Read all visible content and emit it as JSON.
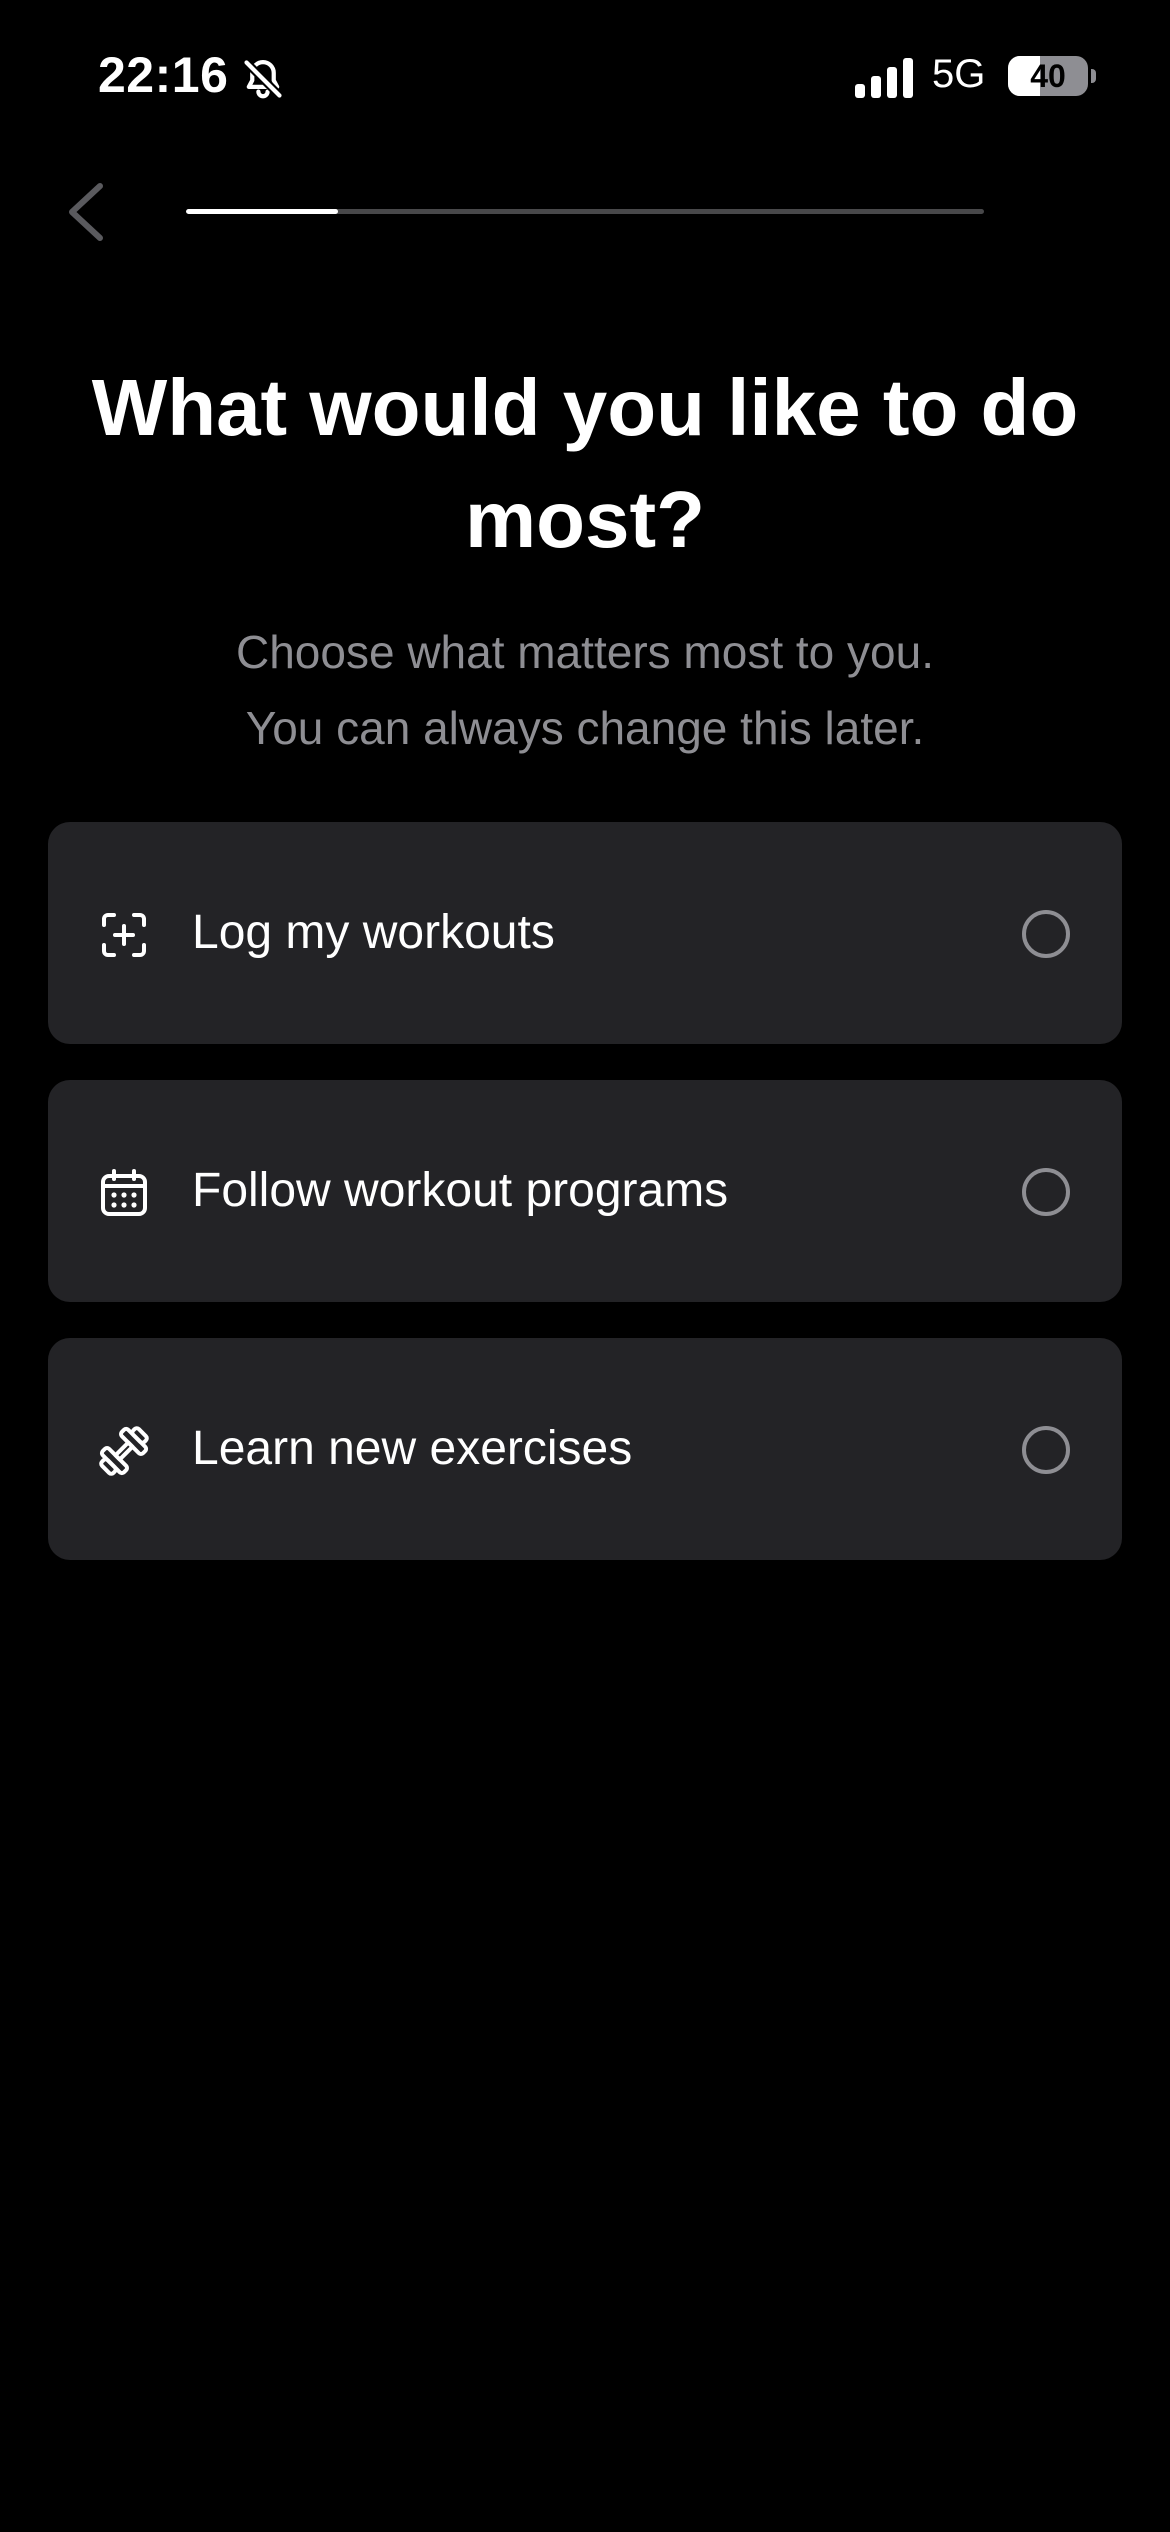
{
  "status_bar": {
    "time": "22:16",
    "network": "5G",
    "battery_level": "40",
    "battery_fraction": 0.4,
    "bell_icon": "bell-slash-icon",
    "signal_icon": "cellular-signal-icon"
  },
  "nav": {
    "back_icon": "chevron-left-icon",
    "progress_fraction": 0.19
  },
  "header": {
    "title": "What would you like to do most?",
    "subtitle_line1": "Choose what matters most to you.",
    "subtitle_line2": "You can always change this later."
  },
  "options": [
    {
      "label": "Log my workouts",
      "icon": "add-frame-icon",
      "selected": false
    },
    {
      "label": "Follow workout programs",
      "icon": "calendar-icon",
      "selected": false
    },
    {
      "label": "Learn new exercises",
      "icon": "dumbbell-icon",
      "selected": false
    }
  ],
  "colors": {
    "background": "#000000",
    "card": "#232326",
    "text_primary": "#ffffff",
    "text_secondary": "#8e8e93",
    "progress_track": "#48484a"
  }
}
